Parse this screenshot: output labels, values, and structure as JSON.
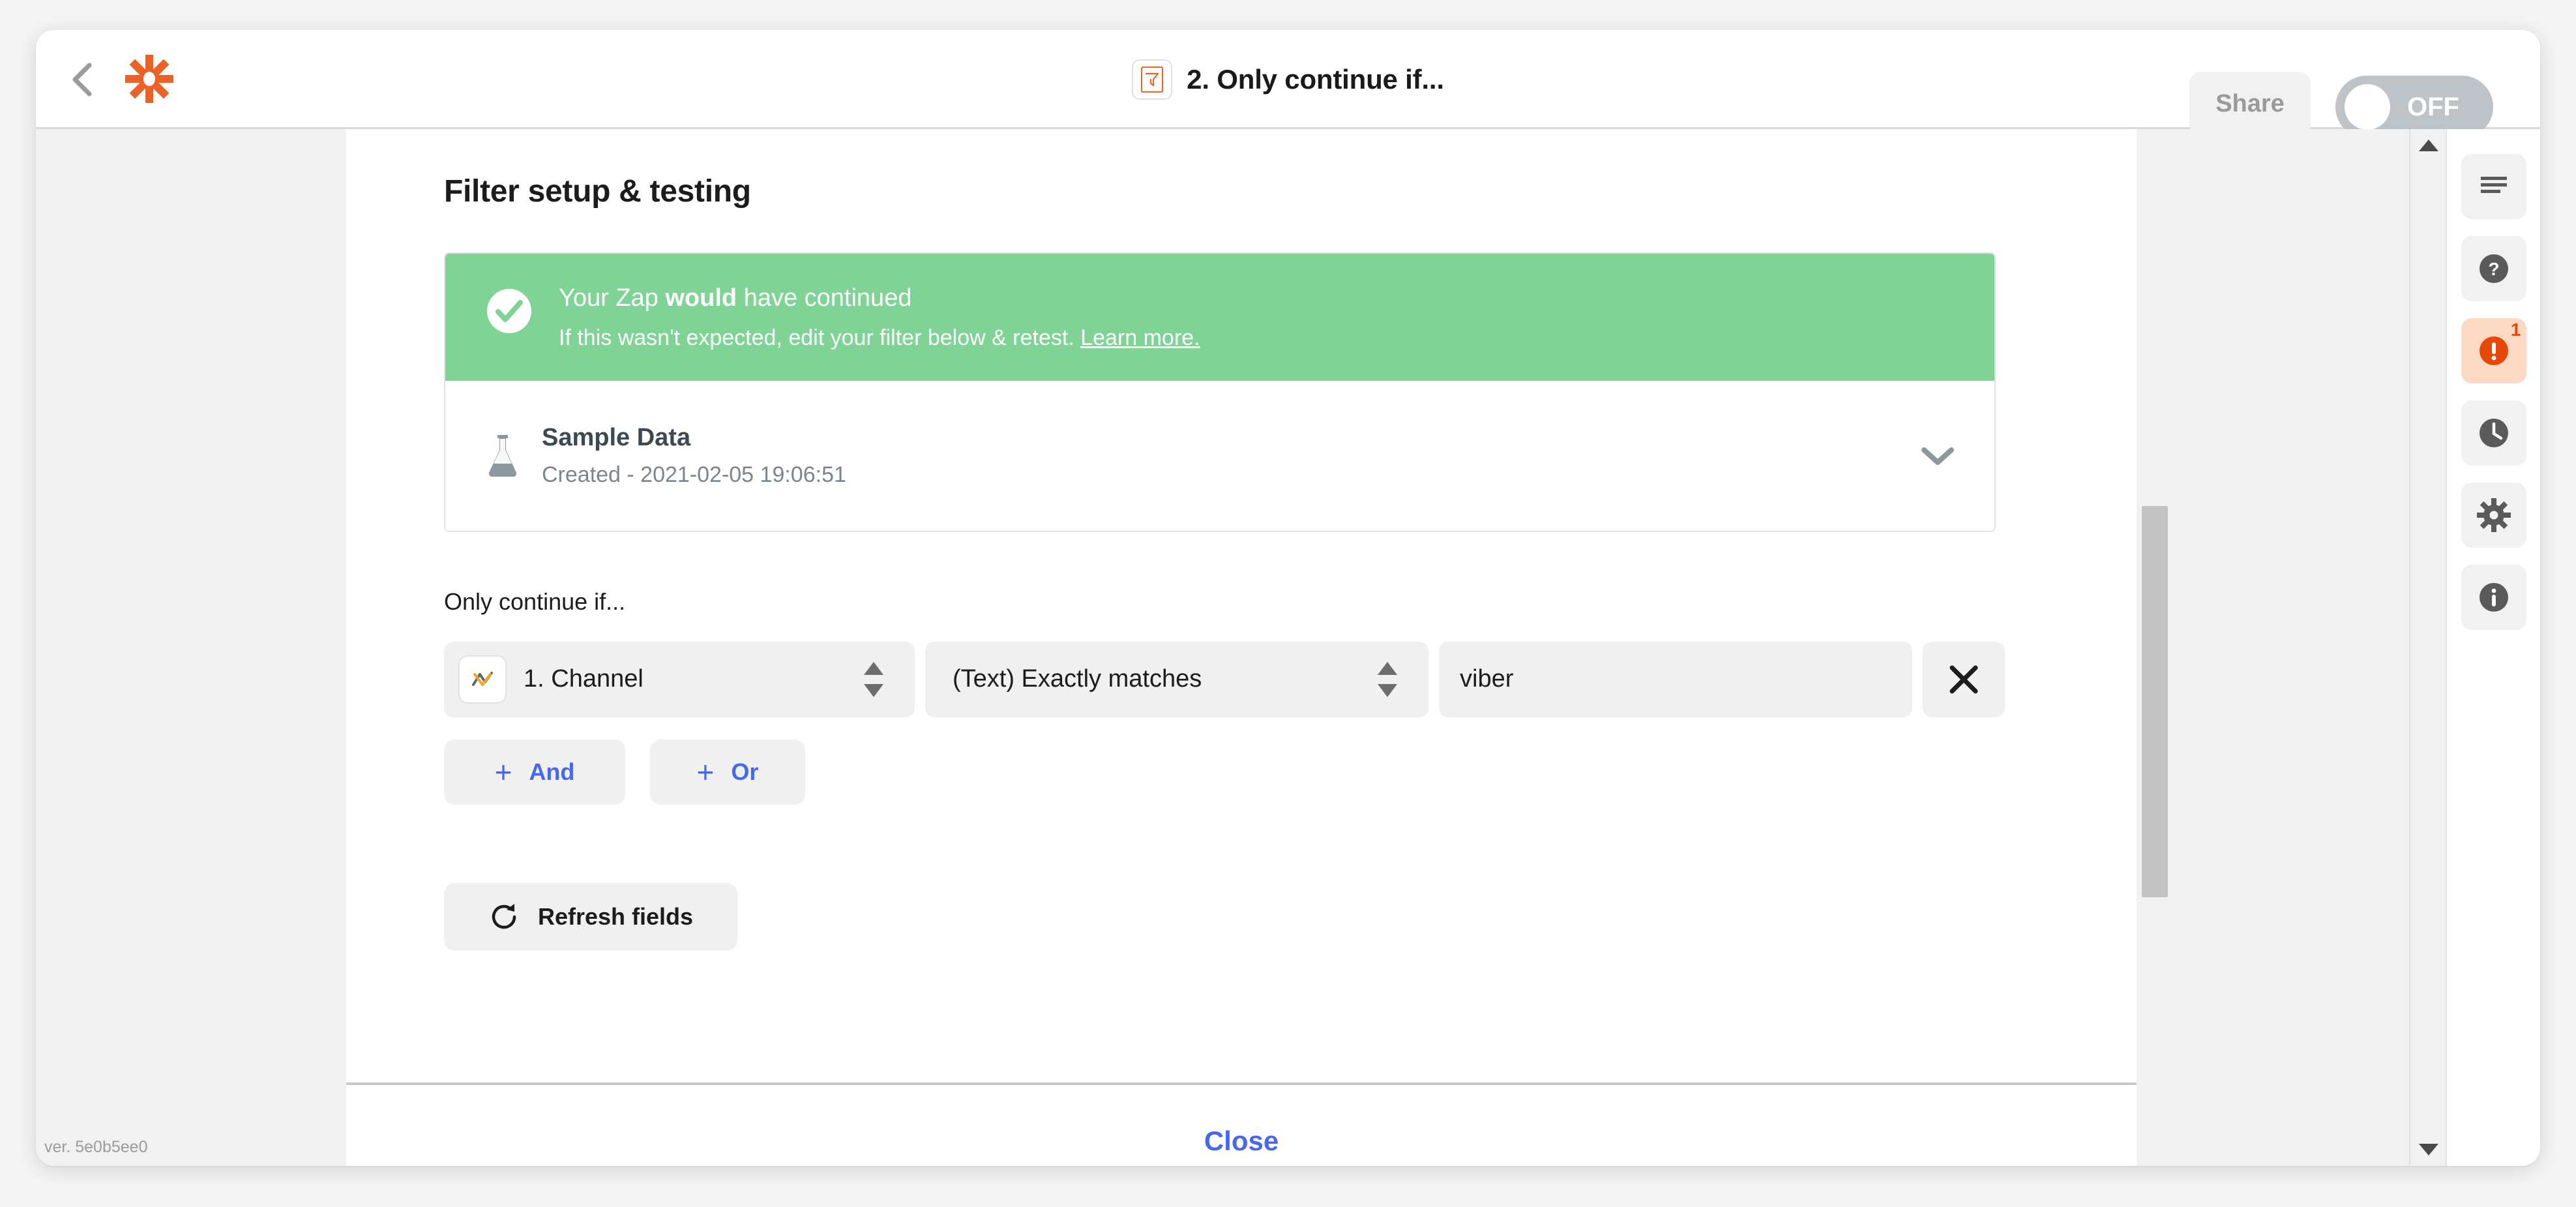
{
  "header": {
    "back_icon": "chevron-left-icon",
    "logo_icon": "zapier-logo-icon",
    "step_icon": "filter-funnel-icon",
    "title": "2. Only continue if...",
    "share_label": "Share",
    "toggle_label": "OFF",
    "toggle_state": "off"
  },
  "modal": {
    "section_title": "Filter setup & testing",
    "result": {
      "status_icon": "check-circle-icon",
      "headline_prefix": "Your Zap ",
      "headline_emphasis": "would",
      "headline_suffix": " have continued",
      "subtext": "If this wasn't expected, edit your filter below & retest. ",
      "link_label": "Learn more.",
      "banner_color": "#7ed395"
    },
    "sample": {
      "icon": "flask-icon",
      "title": "Sample Data",
      "subtitle": "Created - 2021-02-05 19:06:51",
      "expand_icon": "chevron-down-icon"
    },
    "filter": {
      "label": "Only continue if...",
      "field_icon": "app-connector-icon",
      "field_value": "1. Channel",
      "condition_value": "(Text) Exactly matches",
      "value_input": "viber",
      "value_placeholder": "",
      "delete_icon": "close-x-icon",
      "and_label": "And",
      "or_label": "Or",
      "plus_glyph": "+"
    },
    "refresh": {
      "icon": "refresh-icon",
      "label": "Refresh fields"
    },
    "footer": {
      "close_label": "Close"
    }
  },
  "sidebar": {
    "items": [
      {
        "icon": "notes-lines-icon",
        "active": false,
        "badge": ""
      },
      {
        "icon": "help-question-icon",
        "active": false,
        "badge": ""
      },
      {
        "icon": "alert-exclamation-icon",
        "active": true,
        "badge": "1"
      },
      {
        "icon": "history-clock-icon",
        "active": false,
        "badge": ""
      },
      {
        "icon": "settings-gear-icon",
        "active": false,
        "badge": ""
      },
      {
        "icon": "info-circle-icon",
        "active": false,
        "badge": ""
      }
    ]
  },
  "footer": {
    "version": "ver. 5e0b5ee0"
  },
  "colors": {
    "brand_orange": "#ec6226",
    "success_green": "#7ed395",
    "link_blue": "#4568ee",
    "alert_orange": "#e8470a"
  }
}
